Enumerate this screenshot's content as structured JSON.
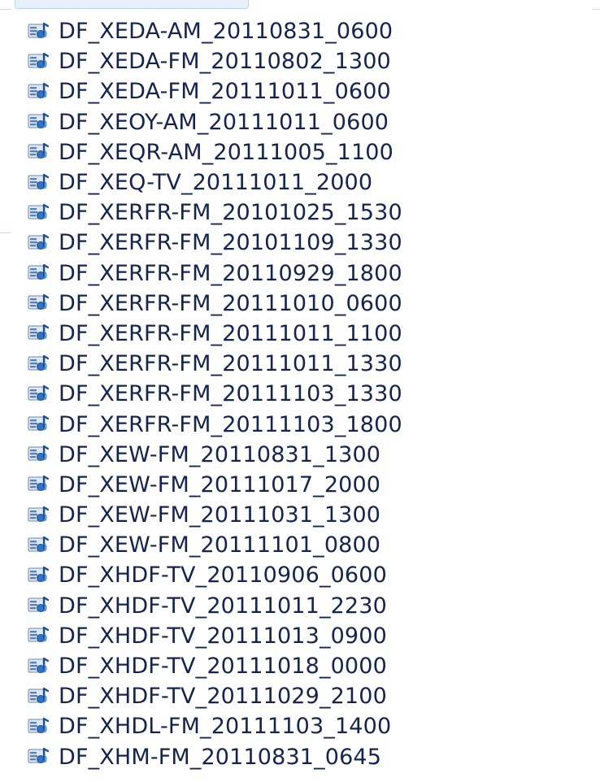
{
  "files": [
    "DF_XEDA-AM_20110831_0600",
    "DF_XEDA-FM_20110802_1300",
    "DF_XEDA-FM_20111011_0600",
    "DF_XEOY-AM_20111011_0600",
    "DF_XEQR-AM_20111005_1100",
    "DF_XEQ-TV_20111011_2000",
    "DF_XERFR-FM_20101025_1530",
    "DF_XERFR-FM_20101109_1330",
    "DF_XERFR-FM_20110929_1800",
    "DF_XERFR-FM_20111010_0600",
    "DF_XERFR-FM_20111011_1100",
    "DF_XERFR-FM_20111011_1330",
    "DF_XERFR-FM_20111103_1330",
    "DF_XERFR-FM_20111103_1800",
    "DF_XEW-FM_20110831_1300",
    "DF_XEW-FM_20111017_2000",
    "DF_XEW-FM_20111031_1300",
    "DF_XEW-FM_20111101_0800",
    "DF_XHDF-TV_20110906_0600",
    "DF_XHDF-TV_20111011_2230",
    "DF_XHDF-TV_20111013_0900",
    "DF_XHDF-TV_20111018_0000",
    "DF_XHDF-TV_20111029_2100",
    "DF_XHDL-FM_20111103_1400",
    "DF_XHM-FM_20110831_0645"
  ],
  "icon": "audio-playlist-file-icon",
  "colors": {
    "text": "#14244f",
    "icon_blue": "#2f74c7",
    "icon_dark": "#1e4f8a",
    "selection": "#e8f1fb"
  }
}
